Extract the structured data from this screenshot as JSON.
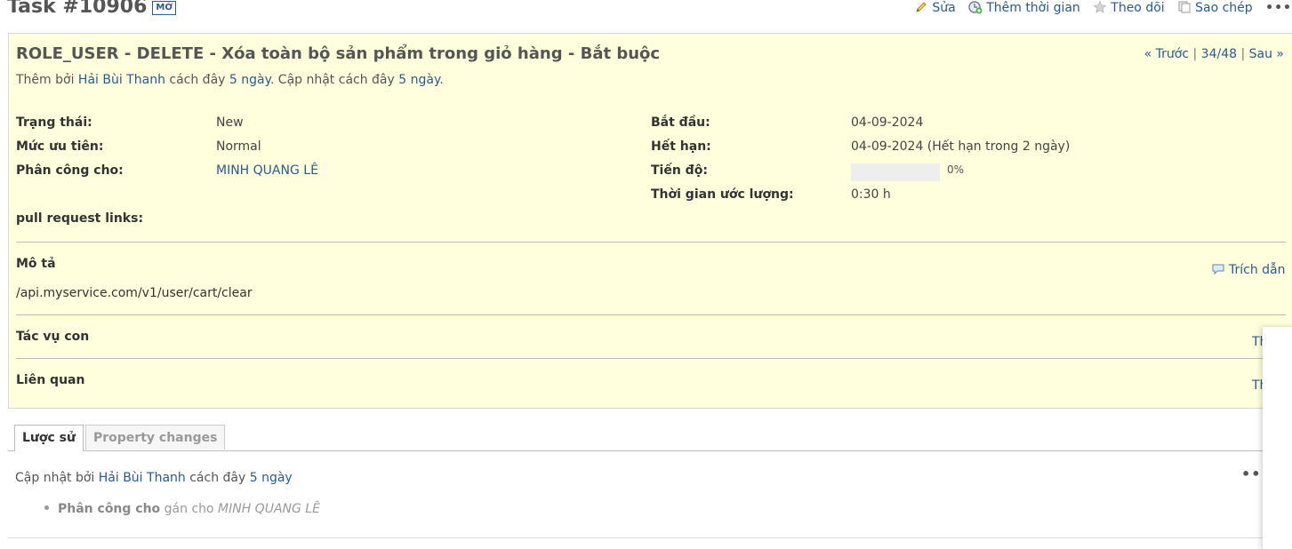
{
  "header": {
    "title": "Task #10906",
    "status_tag": "MỞ",
    "actions": {
      "edit": "Sửa",
      "log_time": "Thêm thời gian",
      "watch": "Theo dõi",
      "copy": "Sao chép",
      "more": "•••"
    }
  },
  "issue": {
    "subject": "ROLE_USER - DELETE - Xóa toàn bộ sản phẩm trong giỏ hàng - Bắt buộc",
    "nav": {
      "prev": "« Trước",
      "sep1": " | ",
      "position": "34/48",
      "sep2": " | ",
      "next": "Sau »"
    },
    "author_line": {
      "prefix": "Thêm bởi ",
      "author": "Hải Bùi Thanh",
      "mid1": " cách đây ",
      "created_ago": "5 ngày",
      "mid2": ". Cập nhật cách đây ",
      "updated_ago": "5 ngày",
      "suffix": "."
    },
    "attributes": {
      "status": {
        "label": "Trạng thái:",
        "value": "New"
      },
      "priority": {
        "label": "Mức ưu tiên:",
        "value": "Normal"
      },
      "assignee": {
        "label": "Phân công cho:",
        "value": "MINH QUANG LÊ"
      },
      "start_date": {
        "label": "Bắt đầu:",
        "value": "04-09-2024"
      },
      "due_date": {
        "label": "Hết hạn:",
        "value": "04-09-2024 (Hết hạn trong 2 ngày)"
      },
      "progress": {
        "label": "Tiến độ:",
        "value": "0%",
        "percent": 0
      },
      "estimated": {
        "label": "Thời gian ước lượng:",
        "value": "0:30 h"
      },
      "pull_request": {
        "label": "pull request links:",
        "value": ""
      }
    },
    "description": {
      "title": "Mô tả",
      "quote": "Trích dẫn",
      "text": "/api.myservice.com/v1/user/cart/clear"
    },
    "subtasks": {
      "title": "Tác vụ con",
      "add_clipped": "Th"
    },
    "relations": {
      "title": "Liên quan",
      "add_clipped": "Th"
    }
  },
  "tabs": [
    {
      "label": "Lược sử",
      "active": true
    },
    {
      "label": "Property changes",
      "active": false
    }
  ],
  "journal": {
    "prefix": "Cập nhật bởi ",
    "author": "Hải Bùi Thanh",
    "mid": " cách đây ",
    "ago": "5 ngày",
    "more": "•••",
    "detail": {
      "field": "Phân công cho",
      "action": " gán cho ",
      "value": "MINH QUANG LÊ"
    }
  }
}
